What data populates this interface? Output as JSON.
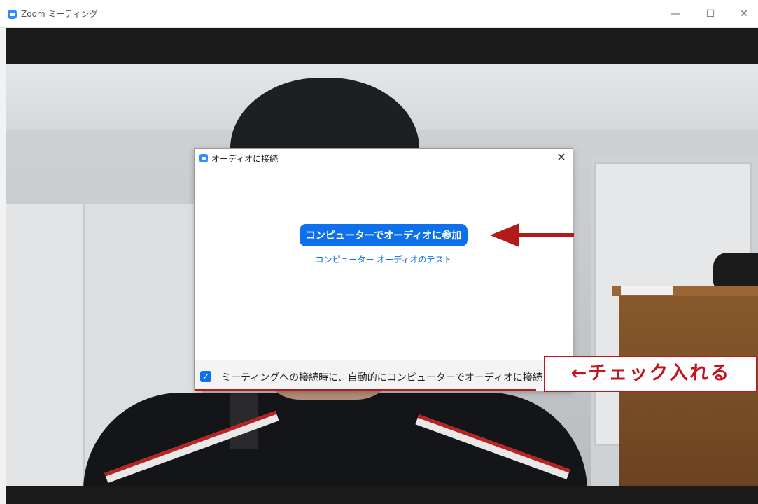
{
  "window": {
    "title": "Zoom ミーティング",
    "minimize_glyph": "—",
    "maximize_glyph": "☐",
    "close_glyph": "✕"
  },
  "dialog": {
    "title": "オーディオに接続",
    "close_glyph": "✕",
    "join_button_label": "コンピューターでオーディオに参加",
    "test_link_label": "コンピューター オーディオのテスト",
    "auto_connect_label": "ミーティングへの接続時に、自動的にコンピューターでオーディオに接続",
    "auto_connect_checked": true,
    "checkbox_glyph": "✓"
  },
  "annotation": {
    "callout_text": "←チェック入れる",
    "color": "#c0141e"
  },
  "colors": {
    "zoom_blue": "#0e71eb",
    "toolbar_dark": "#1a1a1a"
  },
  "icons": [
    "zoom-app-icon",
    "minimize-icon",
    "maximize-icon",
    "close-icon",
    "arrow-left-icon",
    "checkbox-checked-icon"
  ]
}
